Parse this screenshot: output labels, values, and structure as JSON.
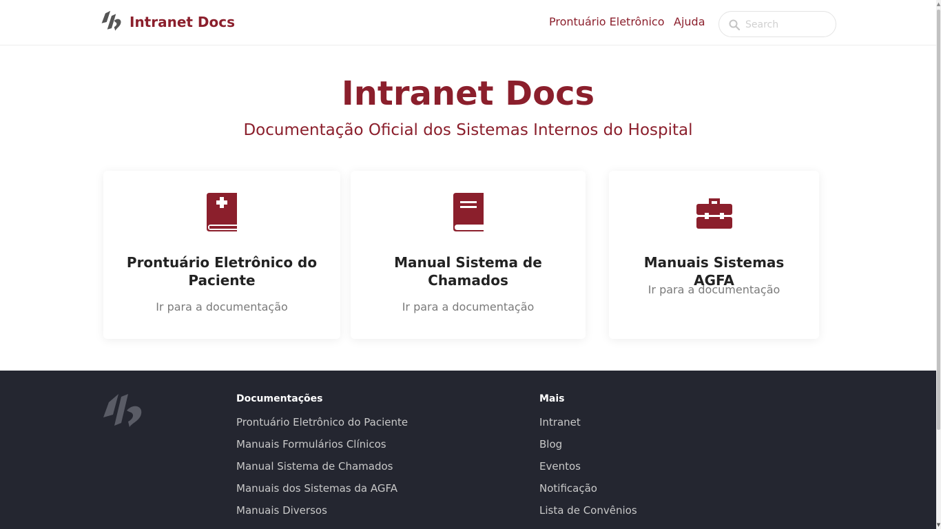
{
  "navbar": {
    "brand_title": "Intranet Docs",
    "links": [
      "Prontuário Eletrônico",
      "Ajuda"
    ],
    "search_placeholder": "Search"
  },
  "hero": {
    "title": "Intranet Docs",
    "subtitle": "Documentação Oficial dos Sistemas Internos do Hospital"
  },
  "cards": [
    {
      "icon": "medical-book-icon",
      "title": "Prontuário Eletrônico do Paciente",
      "link": "Ir para a documentação"
    },
    {
      "icon": "book-icon",
      "title": "Manual Sistema de Chamados",
      "link": "Ir para a documentação"
    },
    {
      "icon": "toolbox-icon",
      "title": "Manuais Sistemas AGFA",
      "link": "Ir para a documentação"
    }
  ],
  "footer": {
    "col1": {
      "title": "Documentações",
      "links": [
        "Prontuário Eletrônico do Paciente",
        "Manuais Formulários Clínicos",
        "Manual Sistema de Chamados",
        "Manuais dos Sistemas da AGFA",
        "Manuais Diversos"
      ]
    },
    "col2": {
      "title": "Mais",
      "links": [
        "Intranet",
        "Blog",
        "Eventos",
        "Notificação",
        "Lista de Convênios"
      ]
    }
  },
  "colors": {
    "brand": "#8b1f2c",
    "footer_bg": "#242630",
    "footer_link": "#c9c9c9"
  }
}
